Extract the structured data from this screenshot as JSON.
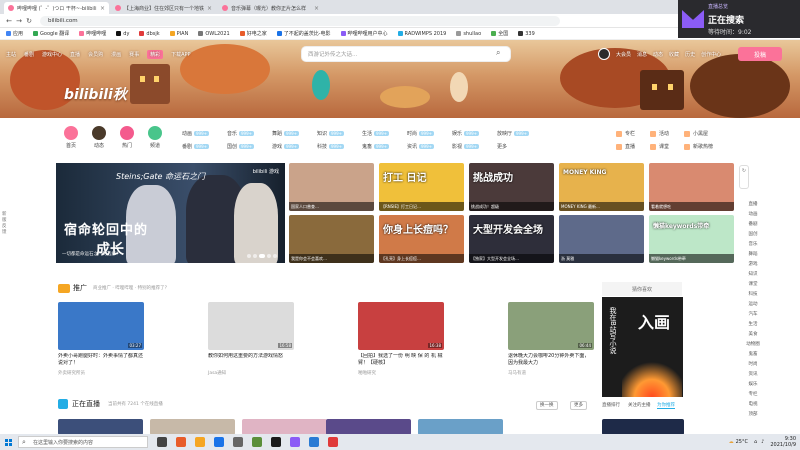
{
  "browser": {
    "tabs": [
      {
        "label": "哔哩哔哩 (゜-゜)つロ 干杯~-bilibili",
        "active": true
      },
      {
        "label": "【上海商业】住在郊区只有一个地铁",
        "active": false
      },
      {
        "label": "音乐弹幕（曝光）教你正片怎么样",
        "active": false
      }
    ],
    "url": "bilibili.com",
    "bookmarks": [
      "应用",
      "Google 翻译",
      "哔哩哔哩",
      "dy",
      "dbsjk",
      "PIAN",
      "OWL2021",
      "好电之家",
      "了不起的盖茨比-电影",
      "哔哩哔哩用户中心",
      "RADWIMPS 2019",
      "shullao",
      "全国",
      "339"
    ]
  },
  "overlay": {
    "small_text": "直播总览",
    "main_text": "正在搜索",
    "wait_label": "等待时间：9:02"
  },
  "site": {
    "logo": "bilibili秋",
    "topnav": [
      "主站",
      "番剧",
      "游戏中心",
      "直播",
      "会员购",
      "漫画",
      "赛事",
      "精彩",
      "下载APP"
    ],
    "topnav_highlight": "精彩",
    "search_placeholder": "西游记外传之大话…",
    "right_nav": [
      "大会员",
      "消息",
      "动态",
      "收藏",
      "历史",
      "创作中心"
    ],
    "upload_label": "投稿"
  },
  "quick_nav": [
    {
      "label": "首页",
      "color": "#fb7299"
    },
    {
      "label": "动态",
      "color": "#4a3a2a"
    },
    {
      "label": "热门",
      "color": "#f45a8d"
    },
    {
      "label": "频道",
      "color": "#49c58b"
    }
  ],
  "categories": [
    {
      "label": "动画",
      "badge": "999+"
    },
    {
      "label": "音乐",
      "badge": "999+"
    },
    {
      "label": "舞蹈",
      "badge": "999+"
    },
    {
      "label": "知识",
      "badge": "999+"
    },
    {
      "label": "生活",
      "badge": "999+"
    },
    {
      "label": "时尚",
      "badge": "999+"
    },
    {
      "label": "娱乐",
      "badge": "999+"
    },
    {
      "label": "放映厅",
      "badge": "999+"
    },
    {
      "label": "番剧",
      "badge": "999+"
    },
    {
      "label": "国创",
      "badge": "999+"
    },
    {
      "label": "游戏",
      "badge": "999+"
    },
    {
      "label": "科技",
      "badge": "999+"
    },
    {
      "label": "鬼畜",
      "badge": "999+"
    },
    {
      "label": "资讯",
      "badge": "999+"
    },
    {
      "label": "影视",
      "badge": "999+"
    },
    {
      "label": "更多",
      "badge": ""
    }
  ],
  "side_links": [
    {
      "label": "专栏"
    },
    {
      "label": "活动"
    },
    {
      "label": "小黑屋"
    },
    {
      "label": "直播"
    },
    {
      "label": "课堂"
    },
    {
      "label": "新歌热榜"
    }
  ],
  "carousel": {
    "game": "Steins;Gate 命运石之门",
    "headline_1": "宿命轮回中的",
    "headline_2": "成长",
    "caption": "一切都是命运石之门的选择！",
    "badge": "bilibili 游戏"
  },
  "grid": [
    {
      "caption": "国家人口普查…",
      "big": "",
      "color": "#caa38a"
    },
    {
      "caption": "【RNSIE】打工日记…",
      "big": "打工 日记",
      "color": "#f0c03a"
    },
    {
      "caption": "挑战成功！超级",
      "big": "挑战成功",
      "color": "#4b3a3a"
    },
    {
      "caption": "MONEY KING 最新…",
      "big": "MONEY KING",
      "color": "#e7b24c"
    },
    {
      "caption": "看着就想吃",
      "big": "",
      "color": "#d98a70"
    },
    {
      "caption": "我是你会不会喜欢…",
      "big": "",
      "color": "#8a6a3c"
    },
    {
      "caption": "【孔亮】身上长痘痘…",
      "big": "你身上长痘吗？",
      "color": "#d07a48"
    },
    {
      "caption": "【独家】大型开发会全场…",
      "big": "大型开发会全场",
      "color": "#2e2e3a"
    },
    {
      "caption": "浙 莫雅",
      "big": "",
      "color": "#5e6a8a"
    },
    {
      "caption": "懒猫keywords带牵",
      "big": "懒猫keywords带牵",
      "color": "#bde7c8"
    }
  ],
  "promo": {
    "title": "推广",
    "note": "商业推广 · 哔哩哔哩 · 特别的推荐了？",
    "cards": [
      {
        "title": "外卖小哥跑腿好时：外卖事情了都真还说对了！",
        "author": "外卖研究所员",
        "duration": "03:27",
        "color": "#3a78c8"
      },
      {
        "title": "教你如何用这重要的方法游戏情怒",
        "author": "Jasa通知",
        "duration": "16:58",
        "color": "#dcdcdc"
      },
      {
        "title": "【回拍】我选了一份 明 映 保 的 机 械 臂！【硬核】",
        "author": "啪啪研究",
        "duration": "16:38",
        "color": "#c84040"
      },
      {
        "title": "退休晚大力会咖啡20分钟外卖下面，因为我最大力",
        "author": "马马有道",
        "duration": "06:44",
        "color": "#8aa07a"
      }
    ]
  },
  "ad": {
    "label": "猜你喜欢",
    "vertical": "我在B站写小说",
    "big": "入画"
  },
  "live": {
    "title": "正在直播",
    "count": "当前共有 7241 个在线直播",
    "refresh_label": "换一换",
    "more_label": "更多",
    "tabs": [
      "直播排行",
      "关注的主播",
      "为你推荐"
    ],
    "active_tab": "为你推荐"
  },
  "rail": [
    "直播",
    "动画",
    "番剧",
    "国创",
    "音乐",
    "舞蹈",
    "游戏",
    "知识",
    "课堂",
    "科技",
    "运动",
    "汽车",
    "生活",
    "美食",
    "动物圈",
    "鬼畜",
    "时尚",
    "资讯",
    "娱乐",
    "专栏",
    "电视",
    "顶部"
  ],
  "left_rail": "新版反馈",
  "taskbar": {
    "search_placeholder": "在这里输入你要搜索的内容",
    "weather": "25°C",
    "time": "9:30",
    "date": "2021/10/9",
    "icons": [
      "#444",
      "#e85c2a",
      "#f5a623",
      "#1a73e8",
      "#666",
      "#5b8f3a",
      "#1b1b1b",
      "#8b5cf6",
      "#2a7bd4",
      "#e03a3a"
    ]
  },
  "colors": {
    "brand": "#fb7299",
    "live": "#23ade5"
  }
}
